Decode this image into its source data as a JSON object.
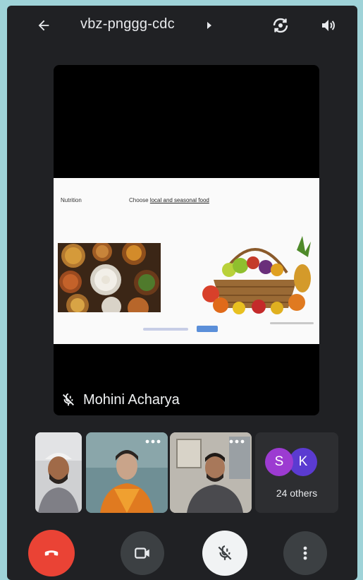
{
  "top_bar": {
    "meeting_code": "vbz-pnggg-cdc"
  },
  "main_tile": {
    "presenter_name": "Mohini Acharya",
    "presenter_muted": true,
    "slide": {
      "title": "Nutrition",
      "subtitle_prefix": "Choose",
      "subtitle_link": "local and seasonal food"
    }
  },
  "participants": {
    "others_initials": [
      "S",
      "K"
    ],
    "others_label": "24 others"
  },
  "colors": {
    "background": "#202124",
    "end_call": "#ea4335",
    "avatar_s": "#9c3bd1",
    "avatar_k": "#5b3bd1"
  },
  "icons": {
    "back": "arrow-left-icon",
    "switch_camera": "switch-camera-icon",
    "speaker": "speaker-icon",
    "end_call": "phone-hangup-icon",
    "camera": "camera-icon",
    "mic": "mic-off-icon",
    "more": "more-vert-icon"
  }
}
